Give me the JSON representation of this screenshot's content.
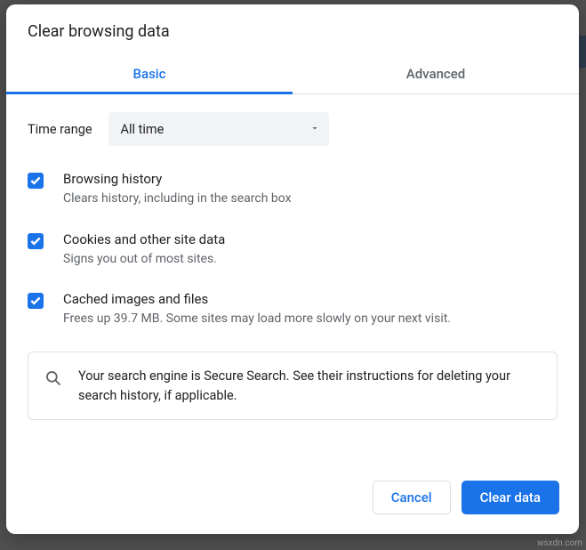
{
  "dialog": {
    "title": "Clear browsing data",
    "tabs": {
      "basic": "Basic",
      "advanced": "Advanced"
    },
    "time_range": {
      "label": "Time range",
      "value": "All time"
    },
    "options": {
      "history": {
        "title": "Browsing history",
        "sub": "Clears history, including in the search box"
      },
      "cookies": {
        "title": "Cookies and other site data",
        "sub": "Signs you out of most sites."
      },
      "cache": {
        "title": "Cached images and files",
        "sub": "Frees up 39.7 MB. Some sites may load more slowly on your next visit."
      }
    },
    "info": "Your search engine is Secure Search. See their instructions for deleting your search history, if applicable.",
    "buttons": {
      "cancel": "Cancel",
      "clear": "Clear data"
    }
  },
  "watermark": "wsxdn.com"
}
